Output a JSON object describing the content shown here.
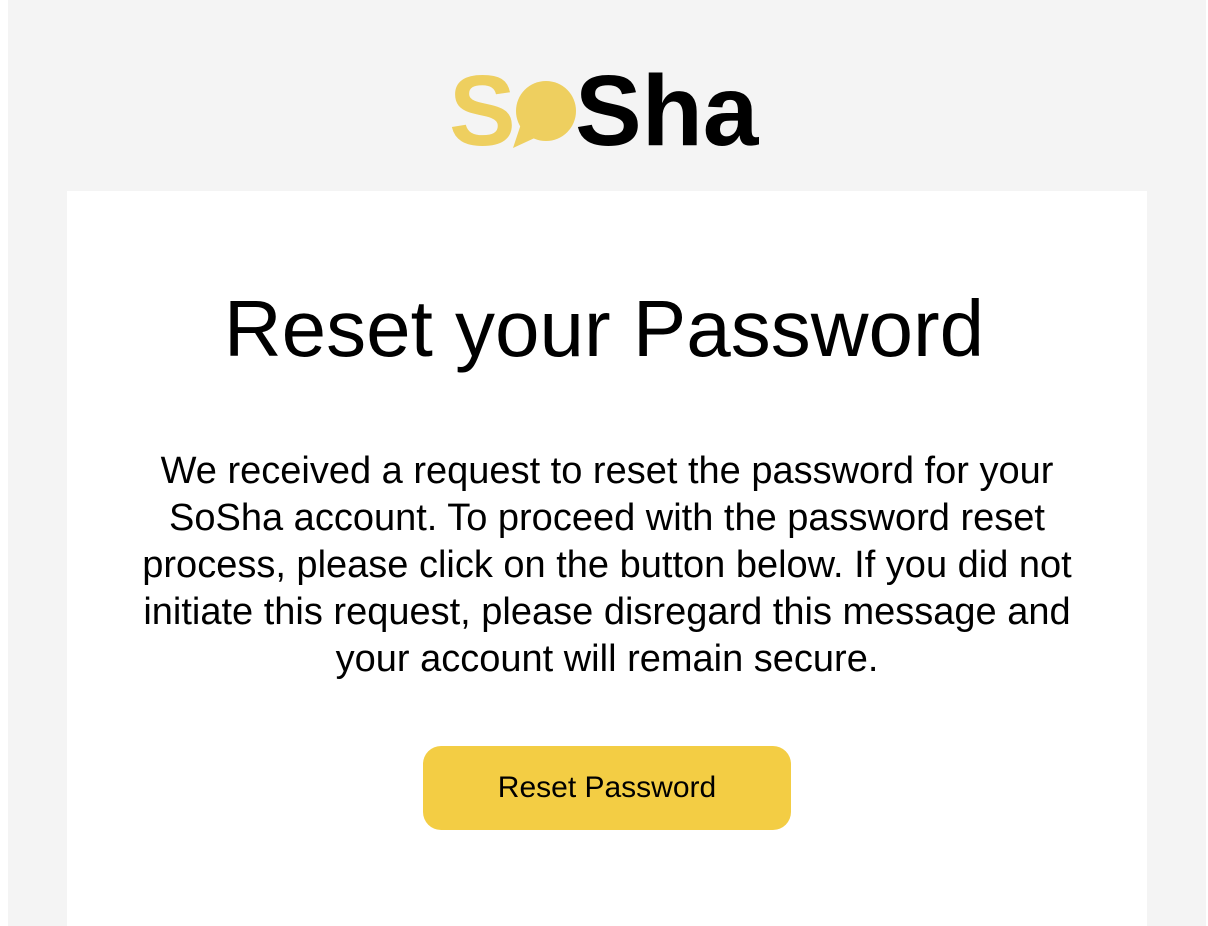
{
  "logo": {
    "part1": "S",
    "part2": "Sha",
    "icon": "speech-bubble-icon",
    "accent_color": "#eecf5f",
    "dark_color": "#000000"
  },
  "email": {
    "title": "Reset your Password",
    "body": "We received a request to reset the password for your SoSha account. To proceed with the password reset process, please click on the button below. If you did not initiate this request, please disregard this message and your account will remain secure.",
    "button_label": "Reset Password",
    "button_color": "#f3cd44"
  }
}
